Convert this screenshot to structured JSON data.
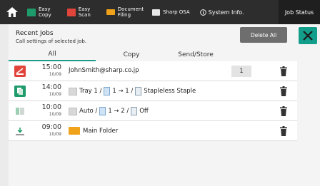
{
  "topbar": {
    "items": [
      {
        "label": "Easy\nCopy",
        "icon": "easy-copy-icon",
        "color": "#1e9b6b"
      },
      {
        "label": "Easy\nScan",
        "icon": "easy-scan-icon",
        "color": "#e0443a"
      },
      {
        "label": "Document\nFiling",
        "icon": "document-filing-icon",
        "color": "#f0a21b"
      },
      {
        "label": "Sharp OSA",
        "icon": "sharp-osa-icon",
        "color": "#e8e8e8"
      }
    ],
    "system_info": "System Info.",
    "job_status": "Job Status"
  },
  "panel": {
    "title": "Recent Jobs",
    "subtitle": "Call settings of selected job.",
    "delete_all": "Delete All"
  },
  "tabs": [
    {
      "label": "All",
      "active": true
    },
    {
      "label": "Copy",
      "active": false
    },
    {
      "label": "Send/Store",
      "active": false
    }
  ],
  "jobs": [
    {
      "type": "scan",
      "time": "15:00",
      "date": "10/09",
      "text": "JohnSmith@sharp.co.jp",
      "count": "1"
    },
    {
      "type": "copy",
      "time": "14:00",
      "date": "10/09",
      "tray": "Tray 1 /",
      "duplex": "1 → 1 /",
      "finish": "Stapleless Staple"
    },
    {
      "type": "copy-gray",
      "time": "10:00",
      "date": "10/09",
      "tray": "Auto /",
      "duplex": "1 → 2 /",
      "finish": "Off"
    },
    {
      "type": "filing",
      "time": "09:00",
      "date": "10/09",
      "folder": "Main Folder"
    }
  ],
  "colors": {
    "accent": "#129e8a",
    "tab_underline": "#1e9b8b"
  }
}
